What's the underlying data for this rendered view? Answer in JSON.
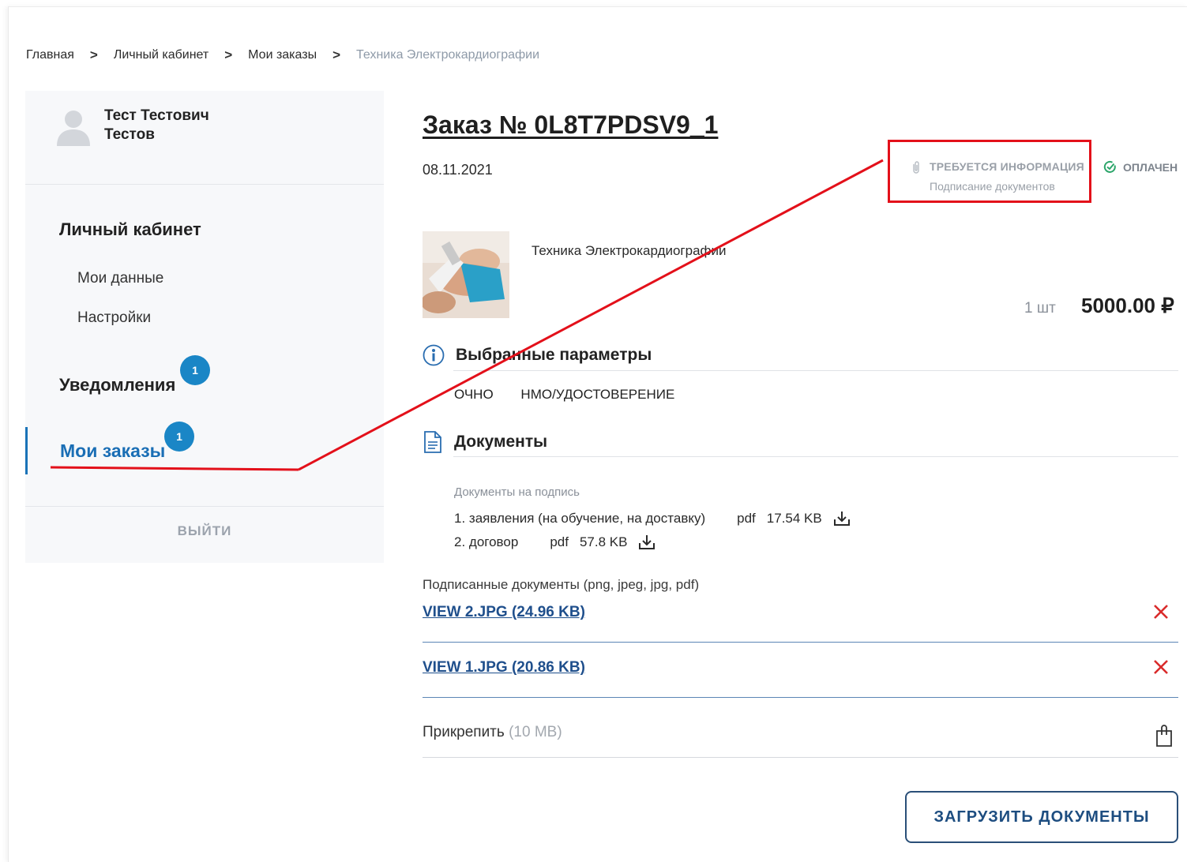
{
  "breadcrumb": {
    "items": [
      "Главная",
      "Личный кабинет",
      "Мои заказы"
    ],
    "current": "Техника Электрокардиографии",
    "separator": ">"
  },
  "profile": {
    "first_line": "Тест Тестович",
    "second_line": "Тестов"
  },
  "sidebar": {
    "cabinet_heading": "Личный кабинет",
    "my_data": "Мои данные",
    "settings": "Настройки",
    "notifications": "Уведомления",
    "notifications_badge": "1",
    "my_orders": "Мои заказы",
    "my_orders_badge": "1",
    "logout": "ВЫЙТИ"
  },
  "order": {
    "title": "Заказ № 0L8T7PDSV9_1",
    "date": "08.11.2021",
    "status_info": "ТРЕБУЕТСЯ ИНФОРМАЦИЯ",
    "status_info_sub": "Подписание документов",
    "status_paid": "ОПЛАЧЕН",
    "product_name": "Техника Электрокардиографии",
    "qty": "1 шт",
    "price": "5000.00 ₽"
  },
  "params": {
    "title": "Выбранные параметры",
    "items": [
      "ОЧНО",
      "НМО/УДОСТОВЕРЕНИЕ"
    ]
  },
  "documents": {
    "title": "Документы",
    "to_sign_label": "Документы на подпись",
    "items": [
      {
        "name": "1. заявления (на обучение, на доставку)",
        "format": "pdf",
        "size": "17.54 KB"
      },
      {
        "name": "2. договор",
        "format": "pdf",
        "size": "57.8 KB"
      }
    ],
    "signed_label": "Подписанные документы (png, jpeg, jpg, pdf)",
    "signed_files": [
      "VIEW 2.JPG (24.96 KB)",
      "VIEW 1.JPG (20.86 KB)"
    ],
    "attach_label": "Прикрепить",
    "attach_limit": "(10 MB)",
    "upload_button": "ЗАГРУЗИТЬ ДОКУМЕНТЫ"
  },
  "colors": {
    "accent": "#1a86c6",
    "annotation_red": "#e3101a",
    "link_blue": "#1f4f8c"
  }
}
